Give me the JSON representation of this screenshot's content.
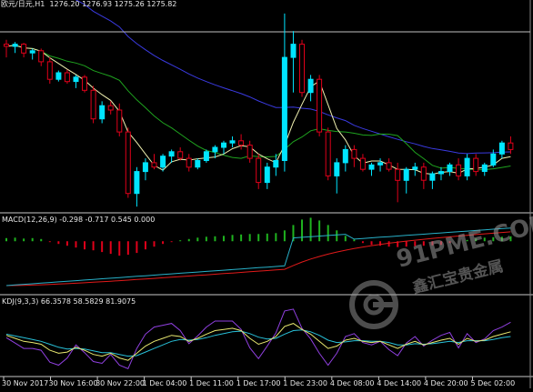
{
  "main_panel": {
    "title": "欧元/日元,H1",
    "ohlc": "1276.20 1276.93 1275.26 1275.82"
  },
  "macd_panel": {
    "label": "MACD(12,26,9) -0.298 -0.717 0.545 0.000"
  },
  "kdj_panel": {
    "label": "KDJ(9,3,3) 66.3578 58.5829 81.9075"
  },
  "time_axis": {
    "labels": [
      "30 Nov 2017",
      "30 Nov 16:00",
      "30 Nov 22:00",
      "1 Dec 04:00",
      "1 Dec 11:00",
      "1 Dec 17:00",
      "1 Dec 23:00",
      "4 Dec 08:00",
      "4 Dec 14:00",
      "4 Dec 20:00",
      "5 Dec 02:00"
    ]
  },
  "watermark": {
    "brand": "91PME.COM",
    "tagline": "鑫汇宝贵金属"
  },
  "colors": {
    "background": "#000000",
    "bull_candle": "#00e5ff",
    "bear_candle": "#e0001a",
    "ma_fast": "#f0f0b0",
    "ma_mid": "#1fa31f",
    "ma_slow": "#3a3ae0",
    "macd_pos": "#1fb31f",
    "macd_neg": "#e0001a",
    "macd_signal": "#e01a1a",
    "macd_main": "#28b0c8",
    "kdj_k": "#e8e870",
    "kdj_d": "#28c0d8",
    "kdj_j": "#9040e0"
  },
  "chart_data": {
    "type": "candlestick",
    "current_price": 1275.82,
    "candles": [
      [
        1273,
        1274,
        1270,
        1272.5
      ],
      [
        1272.5,
        1273.5,
        1271,
        1273
      ],
      [
        1273,
        1273.3,
        1270,
        1271
      ],
      [
        1271,
        1272,
        1269.5,
        1271.5
      ],
      [
        1271.5,
        1272,
        1268,
        1269
      ],
      [
        1269,
        1270,
        1264,
        1265
      ],
      [
        1265,
        1267,
        1264.5,
        1266.5
      ],
      [
        1266.5,
        1267.2,
        1264,
        1264.5
      ],
      [
        1264.5,
        1266,
        1263,
        1265.5
      ],
      [
        1265.5,
        1266,
        1262,
        1262.5
      ],
      [
        1262.5,
        1263.5,
        1255,
        1256
      ],
      [
        1256,
        1260,
        1255,
        1259
      ],
      [
        1259,
        1260,
        1257,
        1258
      ],
      [
        1258,
        1259.5,
        1252,
        1253
      ],
      [
        1253,
        1254,
        1238,
        1239
      ],
      [
        1239,
        1245,
        1236,
        1244
      ],
      [
        1244,
        1247,
        1242,
        1246
      ],
      [
        1246,
        1248,
        1244.5,
        1245
      ],
      [
        1245,
        1248,
        1244,
        1247.5
      ],
      [
        1247.5,
        1249,
        1246,
        1248.5
      ],
      [
        1248.5,
        1249.5,
        1246.5,
        1247
      ],
      [
        1247,
        1248,
        1244,
        1245
      ],
      [
        1245,
        1247,
        1244.5,
        1246.5
      ],
      [
        1246.5,
        1249,
        1246,
        1248.5
      ],
      [
        1248.5,
        1250,
        1247,
        1249.5
      ],
      [
        1249.5,
        1251,
        1248,
        1250.5
      ],
      [
        1250.5,
        1252,
        1249.5,
        1251
      ],
      [
        1251,
        1252.5,
        1249,
        1250
      ],
      [
        1250,
        1251,
        1246,
        1247
      ],
      [
        1247,
        1248,
        1240,
        1241.5
      ],
      [
        1241.5,
        1246,
        1240,
        1245
      ],
      [
        1245,
        1248,
        1243,
        1246.5
      ],
      [
        1246.5,
        1280,
        1244,
        1270
      ],
      [
        1270,
        1276,
        1262,
        1273
      ],
      [
        1273,
        1274,
        1261,
        1262
      ],
      [
        1262,
        1266,
        1260,
        1265
      ],
      [
        1265,
        1266,
        1252,
        1253
      ],
      [
        1253,
        1254,
        1242,
        1243
      ],
      [
        1243,
        1247,
        1239,
        1246
      ],
      [
        1246,
        1250,
        1244,
        1249
      ],
      [
        1249,
        1250,
        1245,
        1247
      ],
      [
        1247,
        1248,
        1244,
        1244.5
      ],
      [
        1244.5,
        1246,
        1243,
        1245.5
      ],
      [
        1245.5,
        1247,
        1244,
        1246
      ],
      [
        1246,
        1247,
        1244,
        1244.5
      ],
      [
        1244.5,
        1246,
        1237,
        1242
      ],
      [
        1242,
        1245,
        1239,
        1244.5
      ],
      [
        1244.5,
        1246,
        1243,
        1245
      ],
      [
        1245,
        1246,
        1240,
        1242
      ],
      [
        1242,
        1244,
        1240,
        1243.5
      ],
      [
        1243.5,
        1245,
        1242,
        1244
      ],
      [
        1244,
        1246,
        1243,
        1245.5
      ],
      [
        1245.5,
        1247,
        1242,
        1243
      ],
      [
        1243,
        1248,
        1242,
        1247
      ],
      [
        1247,
        1248,
        1243,
        1244
      ],
      [
        1244,
        1246,
        1243,
        1245.5
      ],
      [
        1245.5,
        1249,
        1245,
        1248
      ],
      [
        1248,
        1251,
        1247,
        1250.5
      ],
      [
        1250.5,
        1252,
        1248,
        1249
      ]
    ],
    "macd_hist": [
      0.35,
      0.4,
      0.3,
      0.35,
      0.25,
      -0.1,
      -0.3,
      -0.5,
      -0.7,
      -0.9,
      -1.0,
      -1.2,
      -1.4,
      -1.6,
      -1.5,
      -1.3,
      -0.9,
      -0.6,
      -0.3,
      -0.1,
      0.1,
      0.25,
      0.4,
      0.5,
      0.55,
      0.6,
      0.7,
      0.75,
      0.8,
      0.8,
      0.85,
      0.9,
      1.2,
      1.8,
      2.4,
      2.6,
      2.3,
      1.8,
      1.2,
      0.6,
      0.2,
      -0.2,
      -0.4,
      -0.5,
      -0.6,
      -0.65,
      -0.6,
      -0.55,
      -0.5,
      -0.45,
      -0.4,
      -0.2,
      0.0,
      0.15,
      0.3,
      0.4,
      0.45,
      0.5,
      0.55
    ],
    "kdj_k": [
      60,
      55,
      50,
      48,
      45,
      35,
      30,
      32,
      40,
      35,
      28,
      25,
      30,
      22,
      18,
      30,
      42,
      50,
      55,
      60,
      58,
      50,
      55,
      62,
      68,
      70,
      72,
      68,
      55,
      45,
      50,
      58,
      75,
      80,
      70,
      62,
      50,
      38,
      42,
      52,
      55,
      50,
      48,
      50,
      44,
      38,
      45,
      50,
      44,
      48,
      52,
      55,
      45,
      55,
      50,
      52,
      58,
      62,
      66
    ],
    "kdj_d": [
      62,
      59,
      56,
      53,
      50,
      45,
      40,
      37,
      38,
      37,
      34,
      31,
      31,
      28,
      25,
      26,
      32,
      38,
      44,
      50,
      53,
      52,
      53,
      56,
      60,
      63,
      66,
      67,
      63,
      57,
      54,
      55,
      62,
      68,
      69,
      66,
      60,
      52,
      48,
      49,
      51,
      51,
      50,
      50,
      48,
      44,
      44,
      46,
      45,
      46,
      48,
      50,
      48,
      51,
      51,
      51,
      53,
      56,
      58
    ],
    "kdj_j": [
      56,
      47,
      38,
      38,
      35,
      15,
      10,
      22,
      44,
      31,
      16,
      13,
      28,
      10,
      4,
      38,
      62,
      74,
      77,
      80,
      68,
      46,
      59,
      74,
      84,
      84,
      84,
      70,
      39,
      21,
      42,
      64,
      101,
      104,
      72,
      54,
      30,
      10,
      30,
      58,
      63,
      48,
      44,
      50,
      36,
      26,
      47,
      58,
      42,
      52,
      60,
      65,
      39,
      63,
      48,
      54,
      68,
      74,
      82
    ]
  }
}
